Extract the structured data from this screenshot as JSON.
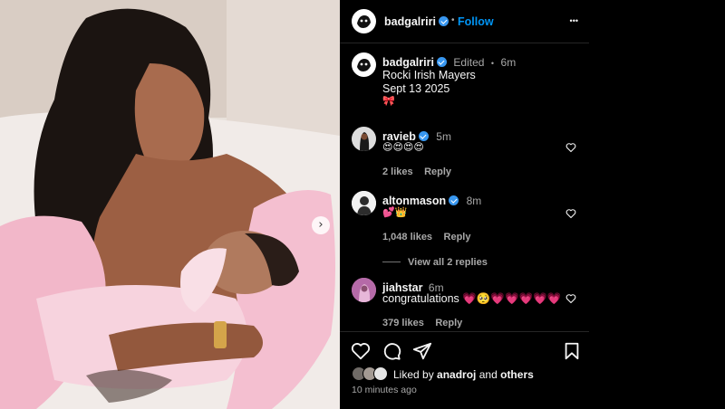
{
  "post": {
    "author": "badgalriri",
    "follow_label": "Follow",
    "separator": "•",
    "more_label": "•••",
    "caption": {
      "edited_label": "Edited",
      "time": "6m",
      "lines": [
        "Rocki Irish Mayers",
        "Sept 13 2025",
        "🎀"
      ]
    },
    "carousel_next": "›"
  },
  "comments": [
    {
      "username": "ravieb",
      "time": "5m",
      "text": "😍😍😍😍",
      "likes": "2 likes",
      "reply": "Reply",
      "verified": true
    },
    {
      "username": "altonmason",
      "time": "8m",
      "text": "💕👑",
      "likes": "1,048 likes",
      "reply": "Reply",
      "verified": true,
      "view_replies": "View all 2 replies"
    },
    {
      "username": "jiahstar",
      "time": "6m",
      "text": "congratulations 💗🥺💗💗💗💗💗",
      "likes": "379 likes",
      "reply": "Reply",
      "verified": false
    }
  ],
  "footer": {
    "liked_by_prefix": "Liked by",
    "liked_by_user": "anadroj",
    "liked_by_and": "and",
    "liked_by_others": "others",
    "time_ago": "10 minutes ago"
  },
  "icons": [
    "heart-icon",
    "comment-icon",
    "share-icon",
    "bookmark-icon",
    "more-icon",
    "verified-badge-icon"
  ],
  "colors": {
    "background": "#000000",
    "accent": "#0095f6",
    "verified": "#3897f0",
    "muted": "#a8a8a8"
  }
}
